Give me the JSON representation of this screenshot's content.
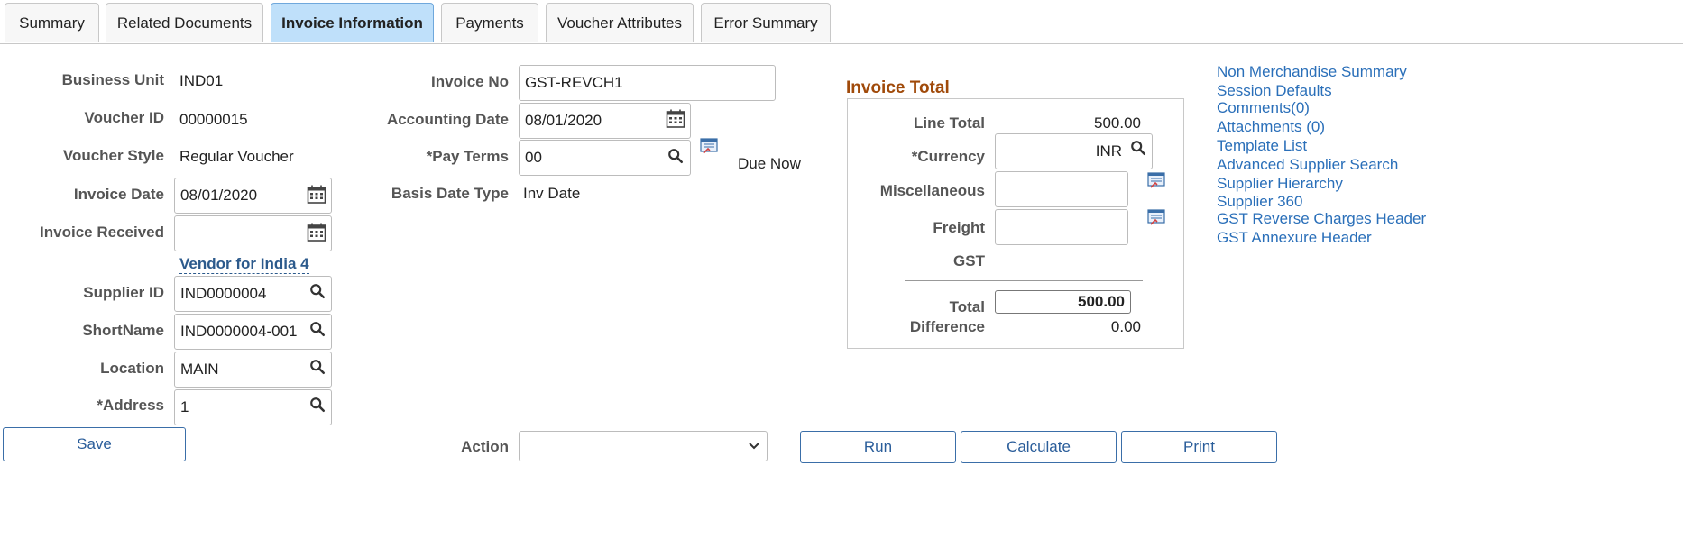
{
  "tabs": [
    {
      "label": "Summary"
    },
    {
      "label": "Related Documents"
    },
    {
      "label": "Invoice Information"
    },
    {
      "label": "Payments"
    },
    {
      "label": "Voucher Attributes"
    },
    {
      "label": "Error Summary"
    }
  ],
  "left": {
    "business_unit_label": "Business Unit",
    "business_unit": "IND01",
    "voucher_id_label": "Voucher ID",
    "voucher_id": "00000015",
    "voucher_style_label": "Voucher Style",
    "voucher_style": "Regular Voucher",
    "invoice_date_label": "Invoice Date",
    "invoice_date": "08/01/2020",
    "invoice_received_label": "Invoice Received",
    "invoice_received": "",
    "vendor_link": "Vendor for India 4",
    "supplier_id_label": "Supplier ID",
    "supplier_id": "IND0000004",
    "shortname_label": "ShortName",
    "shortname": "IND0000004-001",
    "location_label": "Location",
    "location": "MAIN",
    "address_label": "*Address",
    "address": "1"
  },
  "middle": {
    "invoice_no_label": "Invoice No",
    "invoice_no": "GST-REVCH1",
    "accounting_date_label": "Accounting Date",
    "accounting_date": "08/01/2020",
    "pay_terms_label": "*Pay Terms",
    "pay_terms": "00",
    "due_now": "Due Now",
    "basis_date_type_label": "Basis Date Type",
    "basis_date_type": "Inv Date"
  },
  "invoice_total": {
    "title": "Invoice Total",
    "line_total_label": "Line Total",
    "line_total": "500.00",
    "currency_label": "*Currency",
    "currency": "INR",
    "miscellaneous_label": "Miscellaneous",
    "miscellaneous": "",
    "freight_label": "Freight",
    "freight": "",
    "gst_label": "GST",
    "total_label": "Total",
    "total": "500.00",
    "difference_label": "Difference",
    "difference": "0.00"
  },
  "links": [
    "Non Merchandise Summary",
    "Session Defaults",
    "Comments(0)",
    "Attachments (0)",
    "Template List",
    "Advanced Supplier Search",
    "Supplier Hierarchy",
    "Supplier 360",
    "GST Reverse Charges Header",
    "GST Annexure Header"
  ],
  "footer": {
    "save_label": "Save",
    "action_label": "Action",
    "action_value": "",
    "run_label": "Run",
    "calculate_label": "Calculate",
    "print_label": "Print"
  },
  "colors": {
    "accent": "#2a6fb9",
    "section_title": "#a04a0a",
    "active_tab": "#bfe0fa"
  }
}
